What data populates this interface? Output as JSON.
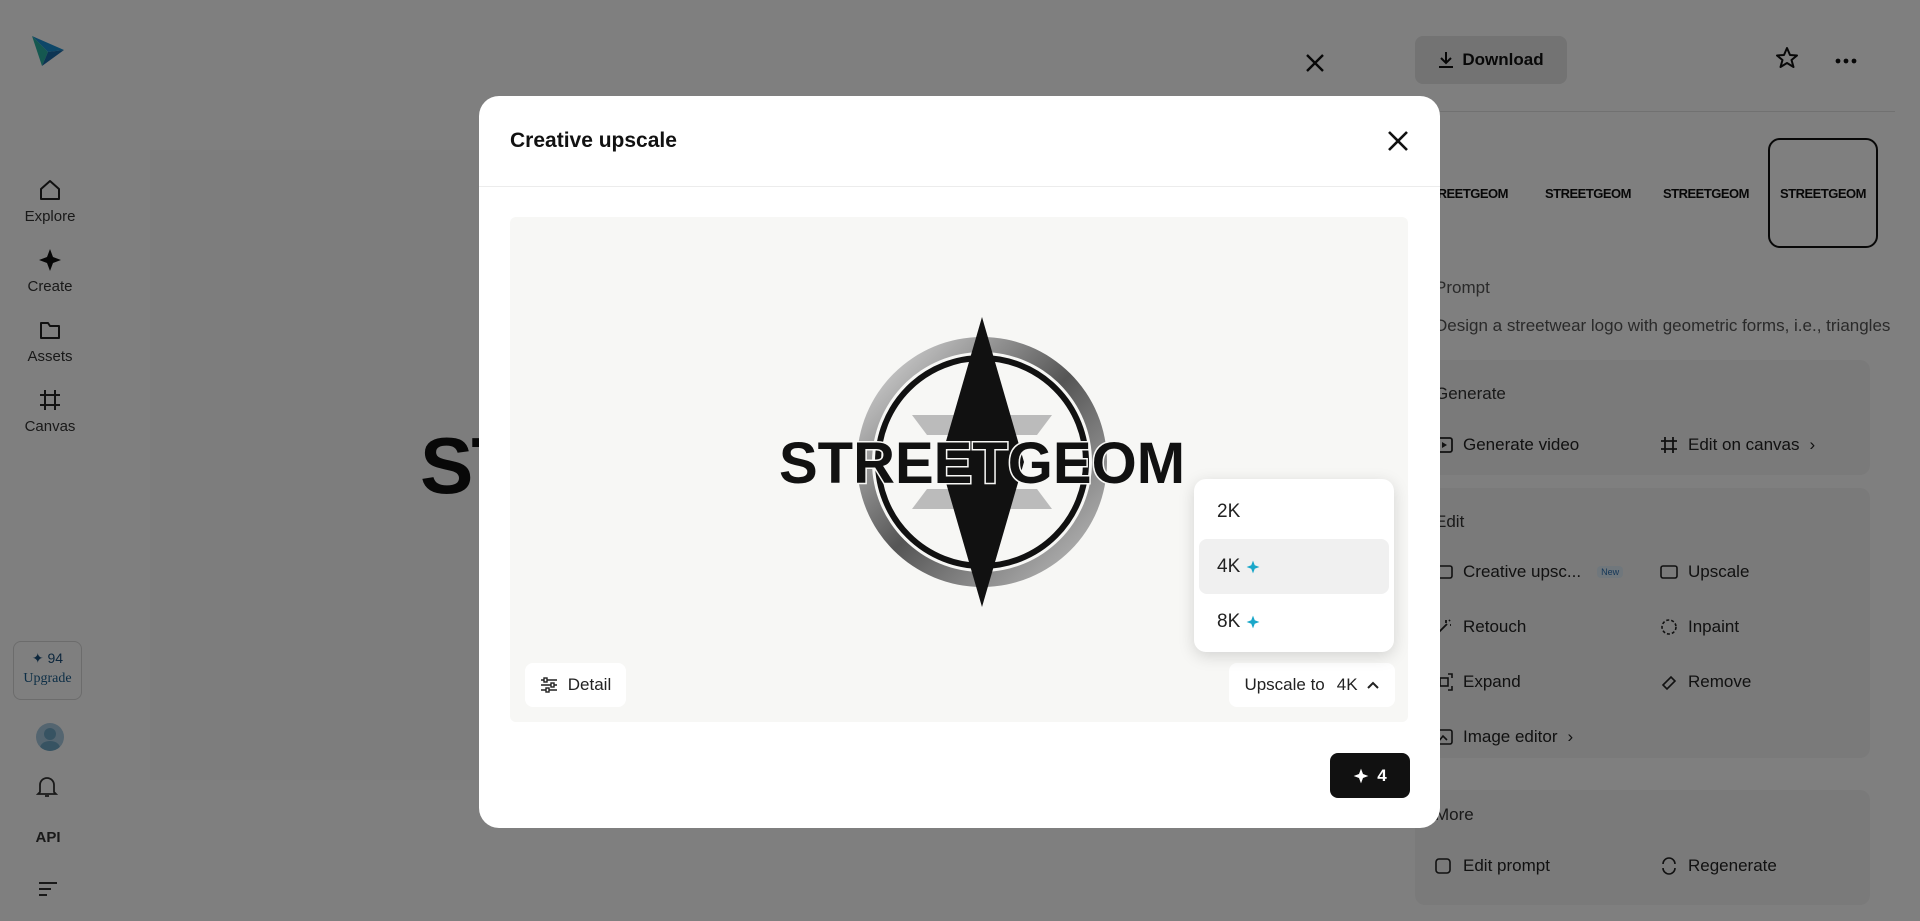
{
  "nav": {
    "items": [
      {
        "label": "Explore",
        "icon": "home-icon"
      },
      {
        "label": "Create",
        "icon": "sparkle-icon"
      },
      {
        "label": "Assets",
        "icon": "folder-icon"
      },
      {
        "label": "Canvas",
        "icon": "canvas-icon"
      }
    ],
    "credits": "✦ 94",
    "upgrade": "Upgrade",
    "api": "API"
  },
  "background": {
    "title_fragment": "ST",
    "download_label": "Download",
    "thumbnail_text": "STREETGEOM",
    "prompt_heading": "Prompt",
    "prompt_text": "Design a streetwear logo with geometric forms, i.e., triangles",
    "generate_heading": "Generate",
    "generate_video": "Generate video",
    "edit_on_canvas": "Edit on canvas",
    "edit_heading": "Edit",
    "creative_upscale": "Creative upsc...",
    "new_badge": "New",
    "upscale": "Upscale",
    "retouch": "Retouch",
    "inpaint": "Inpaint",
    "expand": "Expand",
    "remove": "Remove",
    "image_editor": "Image editor",
    "more_heading": "More",
    "edit_prompt": "Edit prompt",
    "regenerate": "Regenerate"
  },
  "modal": {
    "title": "Creative upscale",
    "logo_text": "STREETGEOM",
    "detail_label": "Detail",
    "upscale_label": "Upscale to",
    "upscale_value": "4K",
    "options": [
      "2K",
      "4K",
      "8K"
    ],
    "selected_option": "4K",
    "cost": "4"
  },
  "colors": {
    "accent_sparkle": "#1aa7c9",
    "primary_button": "#111111"
  }
}
